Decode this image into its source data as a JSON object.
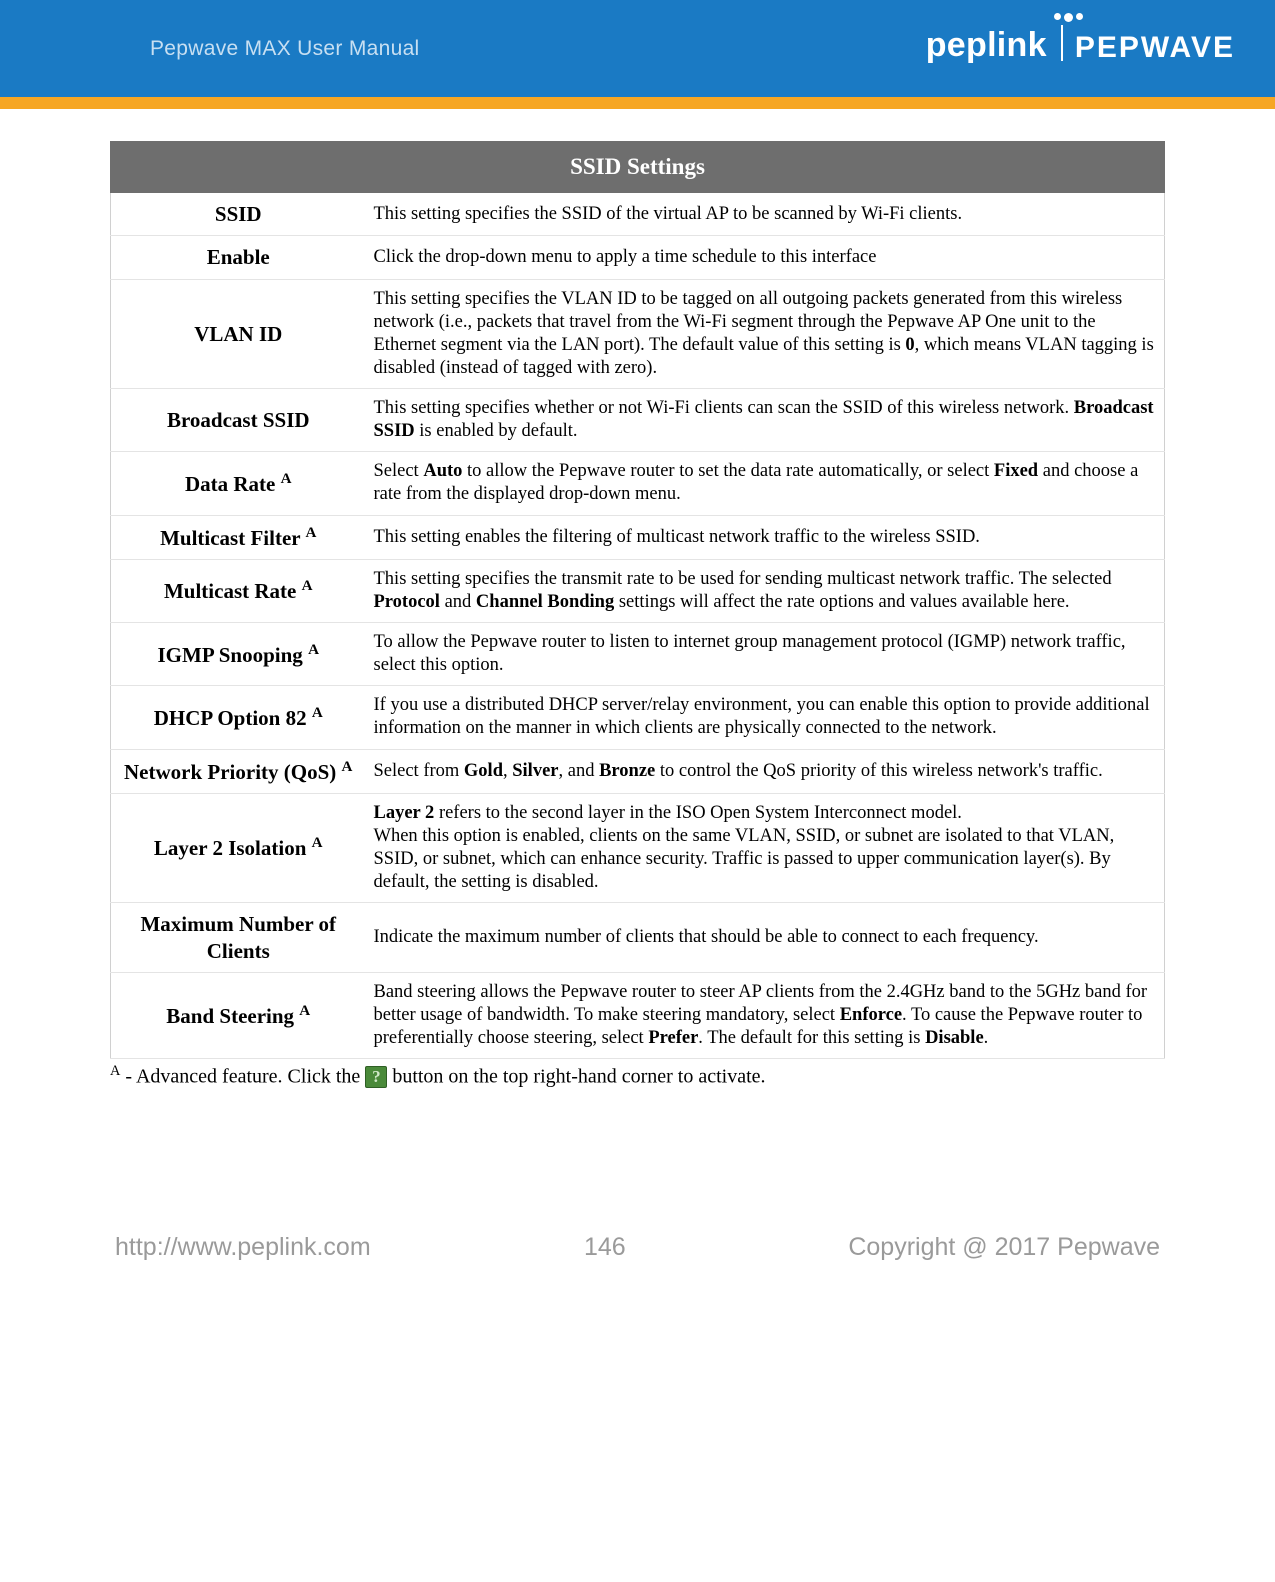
{
  "header": {
    "manual_title": "Pepwave MAX User Manual",
    "brand_left": "peplink",
    "brand_right": "PEPWAVE"
  },
  "table": {
    "title": "SSID Settings",
    "rows": [
      {
        "label": "SSID",
        "sup": "",
        "desc_html": "This setting specifies the SSID of the virtual AP to be scanned by Wi-Fi clients."
      },
      {
        "label": "Enable",
        "sup": "",
        "desc_html": "Click the drop-down menu to apply a time schedule to this interface"
      },
      {
        "label": "VLAN ID",
        "sup": "",
        "desc_html": "This setting specifies the VLAN ID to be tagged on all outgoing packets generated from this wireless network (i.e., packets that travel from the Wi-Fi segment through the Pepwave AP One unit to the Ethernet segment via the LAN port). The default value of this setting is <b>0</b>, which means VLAN tagging is disabled (instead of tagged with zero)."
      },
      {
        "label": "Broadcast SSID",
        "sup": "",
        "desc_html": "This setting specifies whether or not Wi-Fi clients can scan the SSID of this wireless network. <b>Broadcast SSID</b> is enabled by default."
      },
      {
        "label": "Data Rate",
        "sup": "A",
        "desc_html": "Select <b>Auto</b> to allow the Pepwave router to set the data rate automatically, or select <b>Fixed</b> and choose a rate from the displayed drop-down menu."
      },
      {
        "label": "Multicast Filter",
        "sup": "A",
        "desc_html": "This setting enables the filtering of multicast network traffic to the wireless SSID."
      },
      {
        "label": "Multicast Rate",
        "sup": "A",
        "desc_html": "This setting specifies the transmit rate to be used for sending multicast network traffic. The selected <b>Protocol</b> and <b>Channel Bonding</b> settings will affect the rate options and values available here."
      },
      {
        "label": "IGMP Snooping",
        "sup": "A",
        "desc_html": "To allow the Pepwave router to listen to internet group management protocol (IGMP) network traffic, select this option."
      },
      {
        "label": "DHCP Option 82",
        "sup": "A",
        "desc_html": "If you use a distributed DHCP server/relay environment, you can enable this option to provide additional information on the manner in which clients are physically connected to the network."
      },
      {
        "label": "Network Priority (QoS)",
        "sup": "A",
        "desc_html": "Select from <b>Gold</b>, <b>Silver</b>, and <b>Bronze</b> to control the QoS priority of this wireless network's traffic."
      },
      {
        "label": "Layer 2 Isolation",
        "sup": "A",
        "desc_html": "<b>Layer 2</b> refers to the second layer in the ISO Open System Interconnect model.<br>When this option is enabled, clients on the same VLAN, SSID, or subnet are isolated to that VLAN, SSID, or subnet, which can enhance security. Traffic is passed to upper communication layer(s). By default, the setting is disabled."
      },
      {
        "label": "Maximum Number of Clients",
        "sup": "",
        "desc_html": "Indicate the maximum number of clients that should be able to connect to each frequency."
      },
      {
        "label": "Band Steering",
        "sup": "A",
        "desc_html": "Band steering allows the Pepwave router to steer AP clients from the 2.4GHz band to the 5GHz band for better usage of bandwidth. To make steering mandatory, select <b>Enforce</b>. To cause the Pepwave router to preferentially choose steering, select <b>Prefer</b>. The default for this setting is <b>Disable</b>."
      }
    ]
  },
  "footnote": {
    "prefix_sup": "A",
    "text_before": " - Advanced feature. Click the ",
    "text_after": " button on the top right-hand corner to activate.",
    "help_char": "?"
  },
  "footer": {
    "url": "http://www.peplink.com",
    "page": "146",
    "copyright": "Copyright @ 2017 Pepwave"
  }
}
